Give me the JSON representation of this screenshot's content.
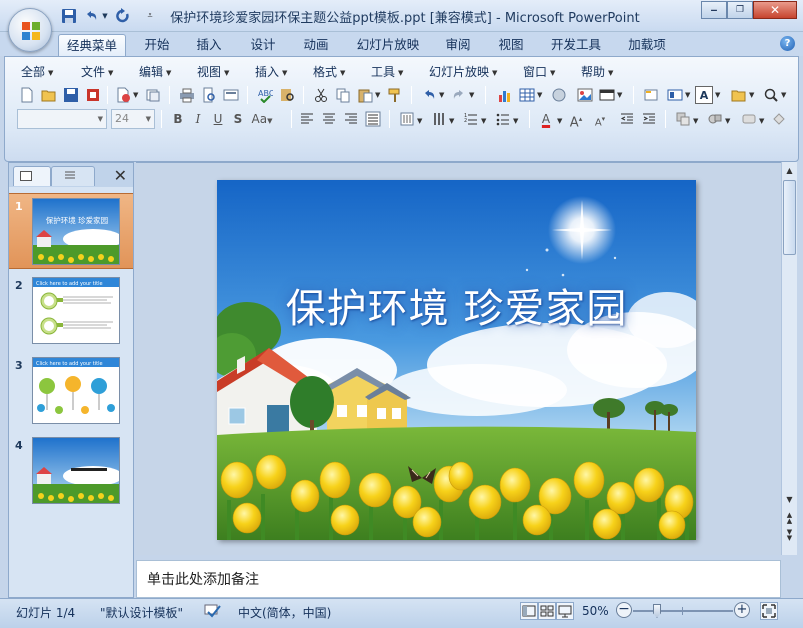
{
  "window": {
    "title": "保护环境珍爱家园环保主题公益ppt模板.ppt [兼容模式] - Microsoft PowerPoint"
  },
  "ribbon_tabs": [
    {
      "label": "经典菜单",
      "active": true
    },
    {
      "label": "开始"
    },
    {
      "label": "插入"
    },
    {
      "label": "设计"
    },
    {
      "label": "动画"
    },
    {
      "label": "幻灯片放映"
    },
    {
      "label": "审阅"
    },
    {
      "label": "视图"
    },
    {
      "label": "开发工具"
    },
    {
      "label": "加载项"
    }
  ],
  "menus": [
    "全部",
    "文件",
    "编辑",
    "视图",
    "插入",
    "格式",
    "工具",
    "幻灯片放映",
    "窗口",
    "帮助"
  ],
  "font_size": "24",
  "slides": [
    {
      "number": "1",
      "selected": true,
      "thumb_title": "保护环境  珍爱家园"
    },
    {
      "number": "2",
      "thumb_header": "Click here to add your title"
    },
    {
      "number": "3",
      "thumb_header": "Click here to add your title"
    },
    {
      "number": "4"
    }
  ],
  "slide": {
    "title": "保护环境  珍爱家园"
  },
  "notes": {
    "placeholder": "单击此处添加备注"
  },
  "status": {
    "slide_info": "幻灯片 1/4",
    "theme": "\"默认设计模板\"",
    "language": "中文(简体，中国)",
    "zoom": "50%"
  },
  "colors": {
    "ribbon_bg": "#dce8f6",
    "selected_thumb": "#e8a06a",
    "sky": "#2f86d8",
    "grass": "#4f9a2a",
    "tulip": "#f5d21c"
  }
}
